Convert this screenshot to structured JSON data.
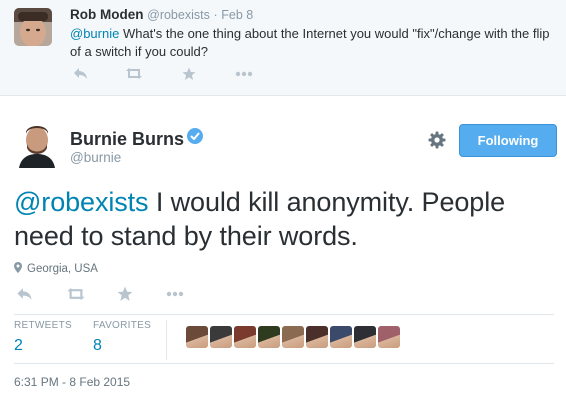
{
  "reply_tweet": {
    "name": "Rob Moden",
    "handle": "@robexists",
    "separator": "·",
    "date": "Feb 8",
    "mention": "@burnie",
    "text": " What's the one thing about the Internet you would \"fix\"/change with the flip of a switch if you could?"
  },
  "main_tweet": {
    "name": "Burnie Burns",
    "handle": "@burnie",
    "follow_button": "Following",
    "mention": "@robexists",
    "text": " I would kill anonymity. People need to stand by their words.",
    "location": "Georgia, USA",
    "stats": {
      "retweets_label": "RETWEETS",
      "retweets": "2",
      "favorites_label": "FAVORITES",
      "favorites": "8"
    },
    "favoriter_colors": [
      "#6b4a3a",
      "#3a3a3a",
      "#7a3b2e",
      "#2f3b1e",
      "#8a6a50",
      "#4a2f2a",
      "#3b4a6a",
      "#2e2e35",
      "#a0606a"
    ],
    "timestamp": "6:31 PM - 8 Feb 2015"
  },
  "colors": {
    "accent": "#55acee",
    "link": "#0084b4",
    "muted": "#8899a6"
  },
  "icons": [
    "reply-icon",
    "retweet-icon",
    "favorite-icon",
    "more-icon",
    "gear-icon",
    "verified-icon",
    "location-pin-icon"
  ]
}
